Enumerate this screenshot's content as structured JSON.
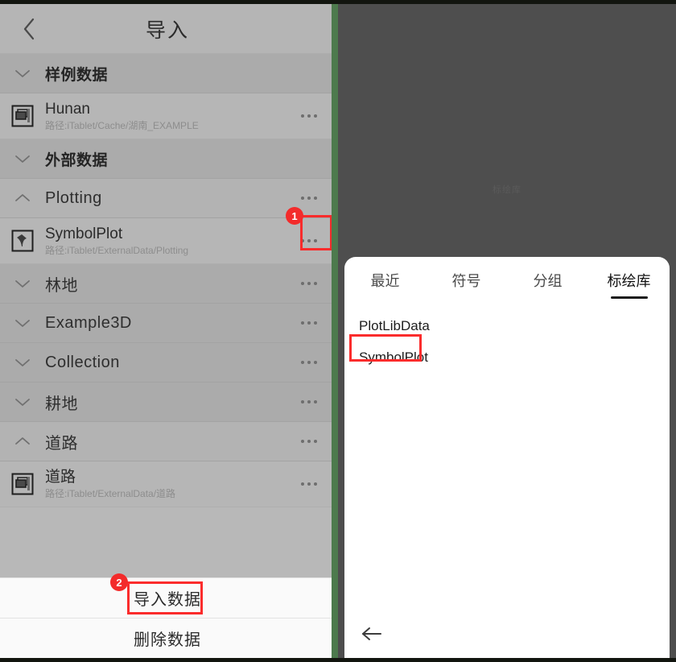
{
  "nav": {
    "title": "导入",
    "back_icon": "chevron-left-icon"
  },
  "left_panel": {
    "groups": [
      {
        "label": "样例数据",
        "type": "section",
        "expanded": true,
        "chevron": "chevron-down-icon",
        "has_menu": false,
        "items": [
          {
            "title": "Hunan",
            "path": "路径:iTablet/Cache/湖南_EXAMPLE",
            "icon": "dataset-stack-icon",
            "menu": "more-dots-icon"
          }
        ]
      },
      {
        "label": "外部数据",
        "type": "section",
        "expanded": true,
        "chevron": "chevron-down-icon",
        "has_menu": false,
        "items": []
      },
      {
        "label": "Plotting",
        "type": "folder",
        "expanded": true,
        "chevron": "chevron-up-icon",
        "has_menu": true,
        "menu": "more-dots-icon",
        "items": [
          {
            "title": "SymbolPlot",
            "path": "路径:iTablet/ExternalData/Plotting",
            "icon": "symbol-plot-icon",
            "menu": "more-dots-icon",
            "highlighted": true
          }
        ]
      },
      {
        "label": "林地",
        "type": "folder",
        "expanded": false,
        "chevron": "chevron-down-icon",
        "has_menu": true,
        "menu": "more-dots-icon",
        "items": []
      },
      {
        "label": "Example3D",
        "type": "folder",
        "expanded": false,
        "chevron": "chevron-down-icon",
        "has_menu": true,
        "menu": "more-dots-icon",
        "items": []
      },
      {
        "label": "Collection",
        "type": "folder",
        "expanded": false,
        "chevron": "chevron-down-icon",
        "has_menu": true,
        "menu": "more-dots-icon",
        "items": []
      },
      {
        "label": "耕地",
        "type": "folder",
        "expanded": false,
        "chevron": "chevron-down-icon",
        "has_menu": true,
        "menu": "more-dots-icon",
        "items": []
      },
      {
        "label": "道路",
        "type": "folder",
        "expanded": true,
        "chevron": "chevron-up-icon",
        "has_menu": true,
        "menu": "more-dots-icon",
        "items": [
          {
            "title": "道路",
            "path": "路径:iTablet/ExternalData/道路",
            "icon": "dataset-stack-icon",
            "menu": "more-dots-icon"
          }
        ]
      }
    ],
    "actions": [
      {
        "label": "导入数据",
        "highlighted": true
      },
      {
        "label": "删除数据",
        "highlighted": false
      }
    ]
  },
  "right_panel": {
    "watermark": "标绘库",
    "tabs": [
      {
        "label": "最近",
        "active": false
      },
      {
        "label": "符号",
        "active": false
      },
      {
        "label": "分组",
        "active": false
      },
      {
        "label": "标绘库",
        "active": true
      }
    ],
    "library_items": [
      {
        "label": "PlotLibData",
        "highlighted": false
      },
      {
        "label": "SymbolPlot",
        "highlighted": true
      }
    ],
    "back_icon": "arrow-left-icon"
  },
  "annotations": {
    "steps": [
      {
        "number": "1",
        "target": "symbolplot-row-menu"
      },
      {
        "number": "2",
        "target": "import-data-button"
      }
    ],
    "accent_color": "#f32b2b"
  }
}
